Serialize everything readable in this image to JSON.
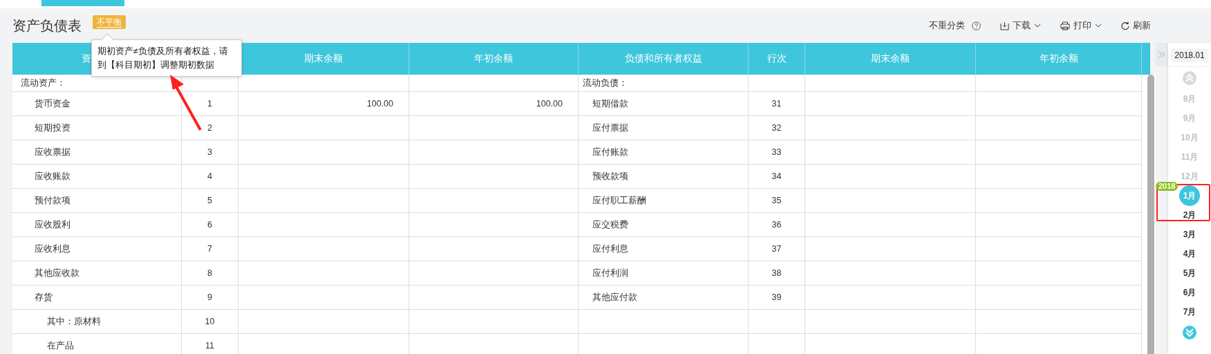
{
  "title": "资产负债表",
  "status_badge": "不平衡",
  "tooltip": {
    "lines": [
      "期初资产≠负债及所有者权益，请",
      "到【科目期初】调整期初数据"
    ]
  },
  "toolbar": {
    "toggle_label": "不重分类",
    "actions": [
      {
        "kind": "download",
        "label": "下载",
        "dropdown": true
      },
      {
        "kind": "print",
        "label": "打印",
        "dropdown": true
      },
      {
        "kind": "refresh",
        "label": "刷新",
        "dropdown": false
      }
    ]
  },
  "table": {
    "columns": [
      {
        "label": "资"
      },
      {
        "label": "期末余额"
      },
      {
        "label": "年初余额"
      },
      {
        "label": "负债和所有者权益"
      },
      {
        "label": "行次"
      },
      {
        "label": "期末余额"
      },
      {
        "label": "年初余额"
      }
    ],
    "rows": [
      {
        "left": {
          "kind": "heading",
          "name": "流动资产："
        },
        "right": {
          "kind": "heading",
          "name": "流动负债："
        }
      },
      {
        "left": {
          "kind": "item",
          "name": "货币资金",
          "line": "1",
          "end": "100.00",
          "begin": "100.00"
        },
        "right": {
          "kind": "item",
          "name": "短期借款",
          "line": "31"
        }
      },
      {
        "left": {
          "kind": "item",
          "name": "短期投资",
          "line": "2"
        },
        "right": {
          "kind": "item",
          "name": "应付票据",
          "line": "32"
        }
      },
      {
        "left": {
          "kind": "item",
          "name": "应收票据",
          "line": "3"
        },
        "right": {
          "kind": "item",
          "name": "应付账款",
          "line": "33"
        }
      },
      {
        "left": {
          "kind": "item",
          "name": "应收账款",
          "line": "4"
        },
        "right": {
          "kind": "item",
          "name": "预收款项",
          "line": "34"
        }
      },
      {
        "left": {
          "kind": "item",
          "name": "预付款项",
          "line": "5"
        },
        "right": {
          "kind": "item",
          "name": "应付职工薪酬",
          "line": "35"
        }
      },
      {
        "left": {
          "kind": "item",
          "name": "应收股利",
          "line": "6"
        },
        "right": {
          "kind": "item",
          "name": "应交税费",
          "line": "36"
        }
      },
      {
        "left": {
          "kind": "item",
          "name": "应收利息",
          "line": "7"
        },
        "right": {
          "kind": "item",
          "name": "应付利息",
          "line": "37"
        }
      },
      {
        "left": {
          "kind": "item",
          "name": "其他应收款",
          "line": "8"
        },
        "right": {
          "kind": "item",
          "name": "应付利润",
          "line": "38"
        }
      },
      {
        "left": {
          "kind": "item",
          "name": "存货",
          "line": "9"
        },
        "right": {
          "kind": "item",
          "name": "其他应付款",
          "line": "39"
        }
      },
      {
        "left": {
          "kind": "sub",
          "name": "其中：原材料",
          "line": "10"
        },
        "right": {
          "kind": "empty"
        }
      },
      {
        "left": {
          "kind": "sub",
          "name": "在产品",
          "line": "11"
        },
        "right": {
          "kind": "empty"
        }
      }
    ]
  },
  "period": {
    "value": "2018.01",
    "months": [
      {
        "label": "8月",
        "previous_year": true,
        "selected": false
      },
      {
        "label": "9月",
        "previous_year": true,
        "selected": false
      },
      {
        "label": "10月",
        "previous_year": true,
        "selected": false
      },
      {
        "label": "11月",
        "previous_year": true,
        "selected": false
      },
      {
        "label": "12月",
        "previous_year": true,
        "selected": false
      },
      {
        "label": "1月",
        "previous_year": false,
        "selected": true,
        "year_badge": "2018"
      },
      {
        "label": "2月",
        "previous_year": false,
        "selected": false
      },
      {
        "label": "3月",
        "previous_year": false,
        "selected": false
      },
      {
        "label": "4月",
        "previous_year": false,
        "selected": false
      },
      {
        "label": "5月",
        "previous_year": false,
        "selected": false
      },
      {
        "label": "6月",
        "previous_year": false,
        "selected": false
      },
      {
        "label": "7月",
        "previous_year": false,
        "selected": false
      }
    ]
  }
}
